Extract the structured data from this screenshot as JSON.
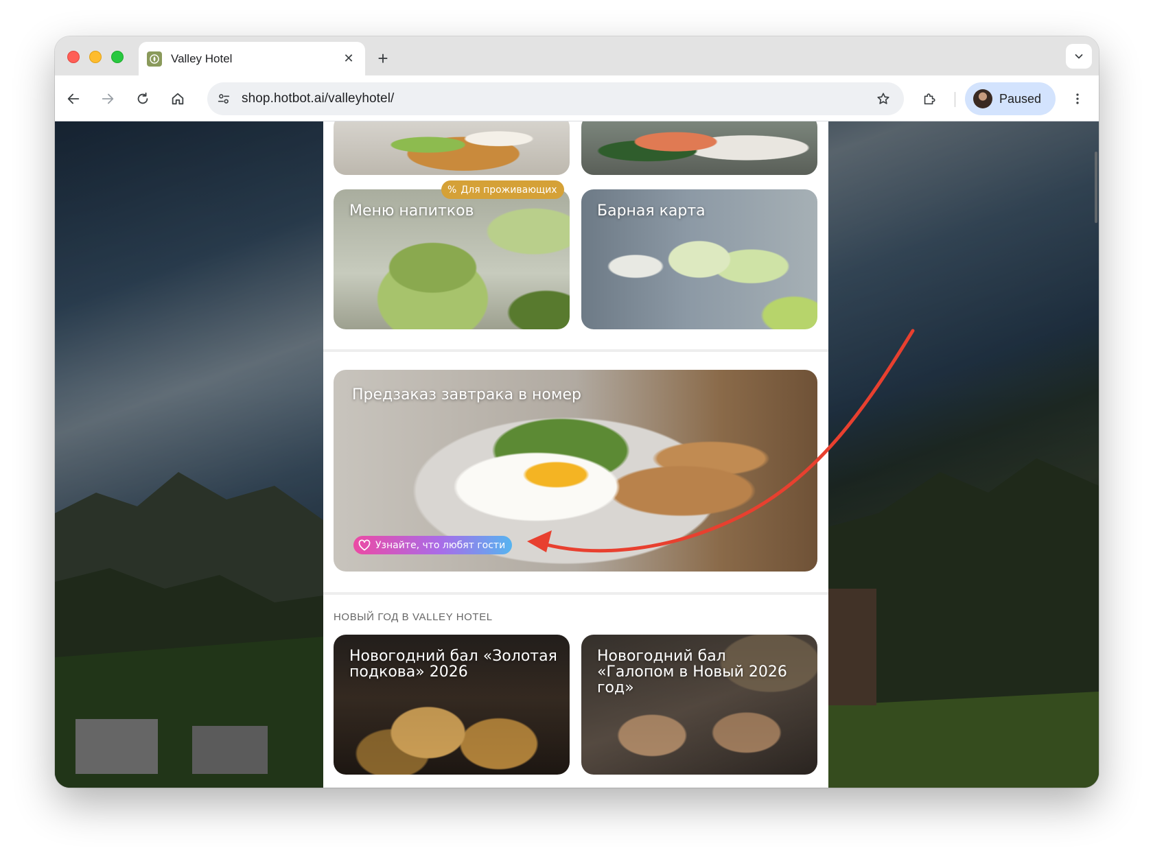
{
  "browser": {
    "tab_title": "Valley Hotel",
    "new_tab_symbol": "+",
    "close_symbol": "✕",
    "url": "shop.hotbot.ai/valleyhotel/",
    "profile_label": "Paused"
  },
  "menu": {
    "cards": [
      {
        "title": "Меню напитков",
        "badge": "Для проживающих"
      },
      {
        "title": "Барная карта"
      }
    ],
    "breakfast": {
      "title": "Предзаказ завтрака в номер",
      "badge": "Узнайте, что любят гости"
    },
    "new_year": {
      "section_label": "НОВЫЙ ГОД В VALLEY HOTEL",
      "cards": [
        {
          "title": "Новогодний бал «Золотая подкова» 2026"
        },
        {
          "title": "Новогодний бал «Галопом в Новый 2026 год»"
        }
      ]
    }
  },
  "colors": {
    "badge_residents": "#d5a137",
    "annotation_arrow": "#e8402f",
    "profile_bg": "#d3e3fd"
  }
}
